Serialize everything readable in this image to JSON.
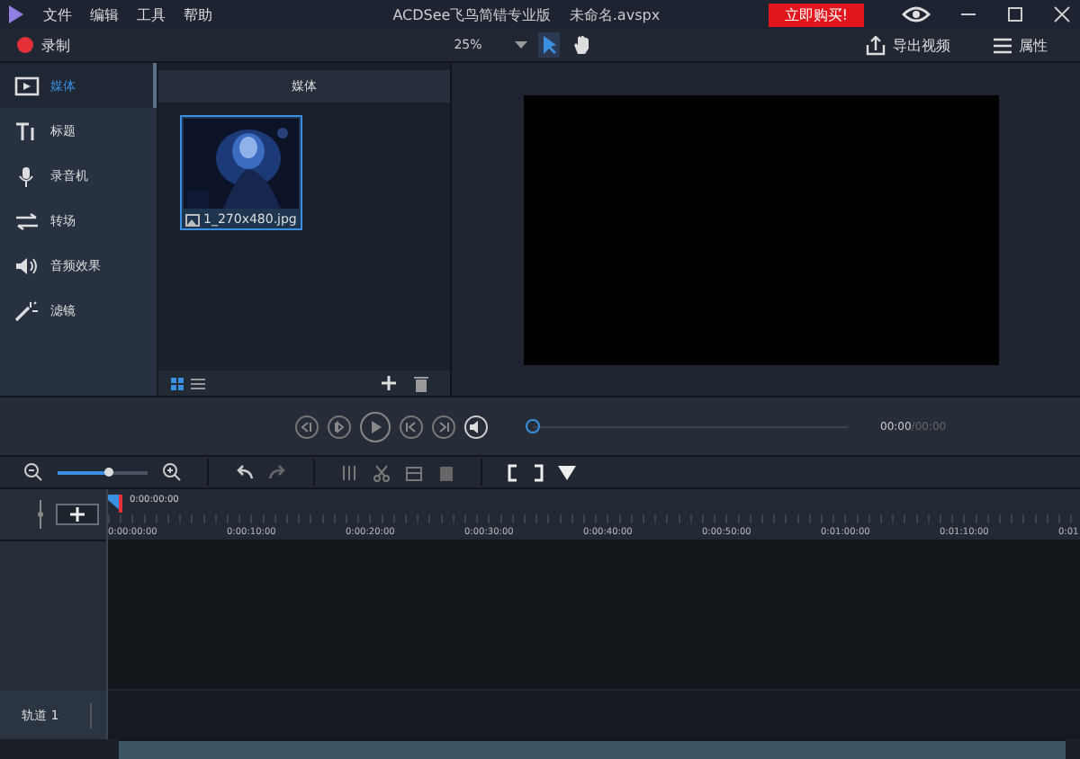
{
  "window": {
    "title": "ACDSee飞鸟简错专业版    未命名.avspx",
    "menu": [
      "文件",
      "编辑",
      "工具",
      "帮助"
    ],
    "buy_button": "立即购买!"
  },
  "toolbar": {
    "record": "录制",
    "zoom": "25%",
    "export": "导出视频",
    "properties": "属性"
  },
  "sidebar": {
    "items": [
      {
        "label": "媒体",
        "kind": "media",
        "selected": true
      },
      {
        "label": "标题",
        "kind": "title",
        "selected": false
      },
      {
        "label": "录音机",
        "kind": "mic",
        "selected": false
      },
      {
        "label": "转场",
        "kind": "transition",
        "selected": false
      },
      {
        "label": "音频效果",
        "kind": "audio",
        "selected": false
      },
      {
        "label": "滤镜",
        "kind": "filter",
        "selected": false
      }
    ]
  },
  "media_panel": {
    "header": "媒体",
    "items": [
      {
        "kind": "picture",
        "filename": "1_270x480.jpg",
        "selected": true
      }
    ]
  },
  "player": {
    "level": 0,
    "time": "00:00",
    "duration": "/00:00"
  },
  "timeline": {
    "zoom_slider": {
      "level": 0.55
    },
    "playhead_time": "0:00:00:00",
    "ruler": [
      "0:00:00:00",
      "0:00:10:00",
      "0:00:20:00",
      "0:00:30:00",
      "0:00:40:00",
      "0:00:50:00",
      "0:01:00:00",
      "0:01:10:00",
      "0:01"
    ],
    "tracks": [
      {
        "label": "轨道 1"
      }
    ]
  }
}
